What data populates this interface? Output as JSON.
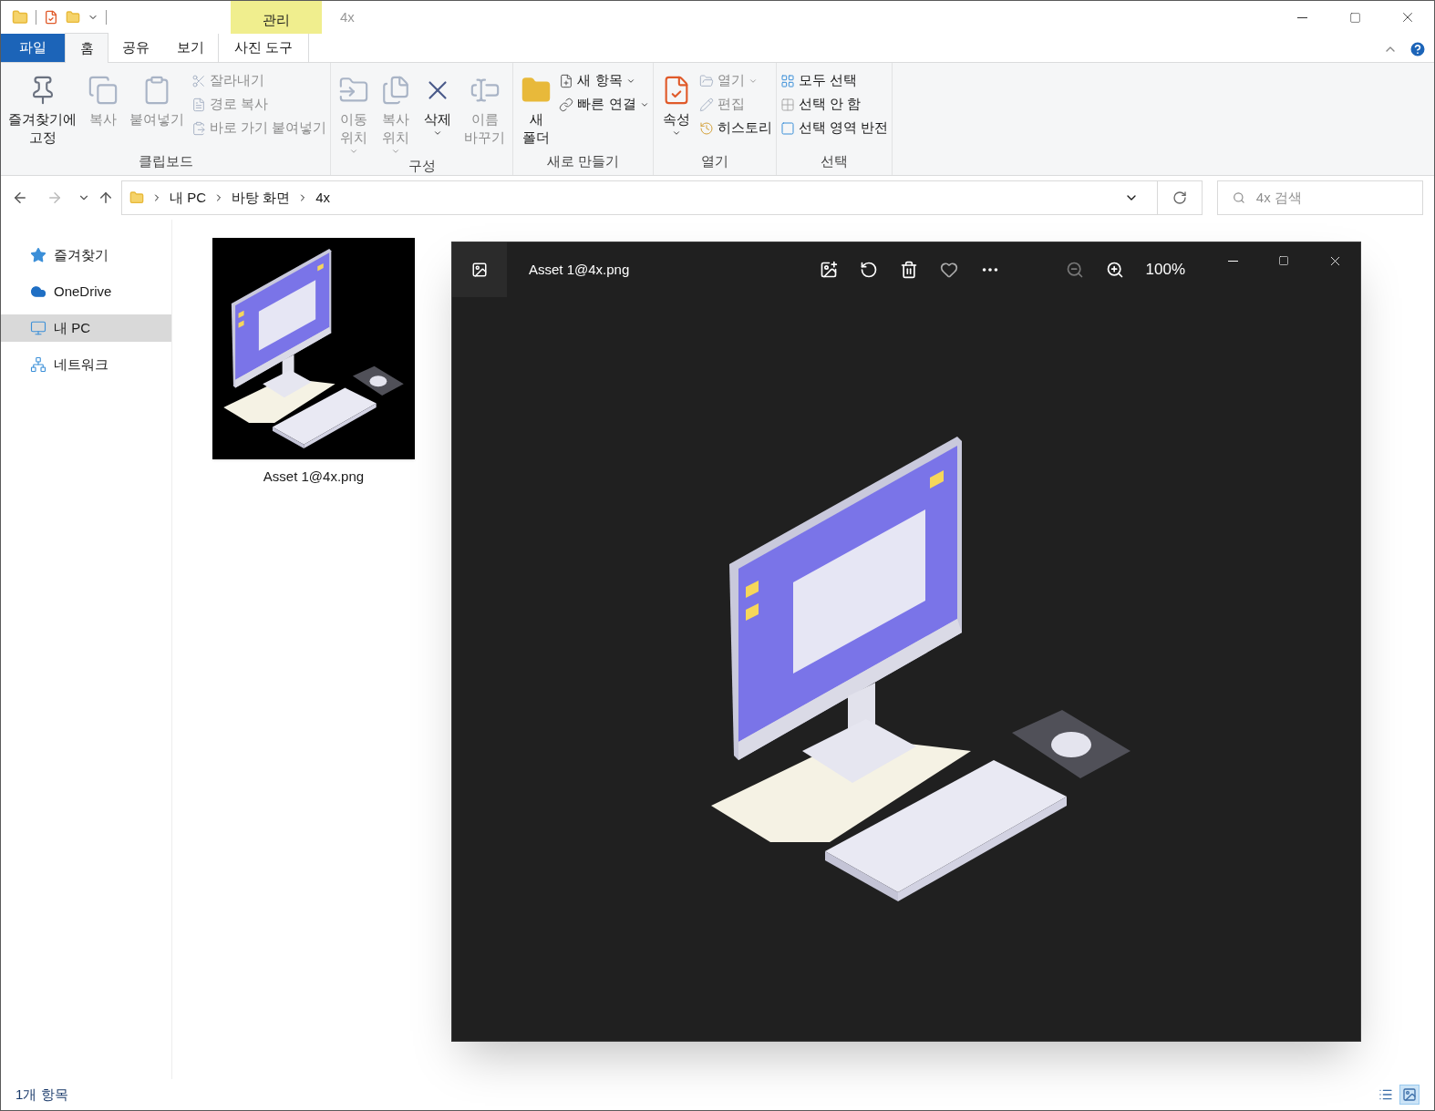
{
  "title_bar": {
    "contextual_tab": "관리",
    "title": "4x"
  },
  "ribbon_tabs": [
    {
      "label": "파일",
      "kind": "file",
      "selected": false
    },
    {
      "label": "홈",
      "kind": "normal",
      "selected": true
    },
    {
      "label": "공유",
      "kind": "normal",
      "selected": false
    },
    {
      "label": "보기",
      "kind": "normal",
      "selected": false
    },
    {
      "label": "사진 도구",
      "kind": "contextual",
      "selected": false
    }
  ],
  "ribbon_groups": [
    {
      "label": "클립보드",
      "items": [
        {
          "kind": "large",
          "lines": [
            "즐겨찾기에",
            "고정"
          ],
          "disabled": false,
          "dropdown": false
        },
        {
          "kind": "large",
          "lines": [
            "복사"
          ],
          "disabled": true,
          "dropdown": false
        },
        {
          "kind": "large",
          "lines": [
            "붙여넣기"
          ],
          "disabled": true,
          "dropdown": false
        },
        {
          "kind": "stack",
          "entries": [
            {
              "label": "잘라내기",
              "disabled": true,
              "dropdown": false
            },
            {
              "label": "경로 복사",
              "disabled": true,
              "dropdown": false
            },
            {
              "label": "바로 가기 붙여넣기",
              "disabled": true,
              "dropdown": false
            }
          ]
        }
      ]
    },
    {
      "label": "구성",
      "items": [
        {
          "kind": "large",
          "lines": [
            "이동",
            "위치"
          ],
          "disabled": true,
          "dropdown": true
        },
        {
          "kind": "large",
          "lines": [
            "복사",
            "위치"
          ],
          "disabled": true,
          "dropdown": true
        },
        {
          "kind": "large",
          "lines": [
            "삭제"
          ],
          "disabled": false,
          "dropdown": true
        },
        {
          "kind": "large",
          "lines": [
            "이름",
            "바꾸기"
          ],
          "disabled": true,
          "dropdown": false
        }
      ]
    },
    {
      "label": "새로 만들기",
      "items": [
        {
          "kind": "large",
          "lines": [
            "새",
            "폴더"
          ],
          "disabled": false,
          "dropdown": false
        },
        {
          "kind": "stack",
          "entries": [
            {
              "label": "새 항목",
              "disabled": false,
              "dropdown": true
            },
            {
              "label": "빠른 연결",
              "disabled": false,
              "dropdown": true
            }
          ]
        }
      ]
    },
    {
      "label": "열기",
      "items": [
        {
          "kind": "large",
          "lines": [
            "속성"
          ],
          "disabled": false,
          "dropdown": true
        },
        {
          "kind": "stack",
          "entries": [
            {
              "label": "열기",
              "disabled": true,
              "dropdown": true
            },
            {
              "label": "편집",
              "disabled": true,
              "dropdown": false
            },
            {
              "label": "히스토리",
              "disabled": false,
              "dropdown": false
            }
          ]
        }
      ]
    },
    {
      "label": "선택",
      "items": [
        {
          "kind": "stack",
          "entries": [
            {
              "label": "모두 선택",
              "disabled": false,
              "dropdown": false
            },
            {
              "label": "선택 안 함",
              "disabled": false,
              "dropdown": false
            },
            {
              "label": "선택 영역 반전",
              "disabled": false,
              "dropdown": false
            }
          ]
        }
      ]
    }
  ],
  "address": {
    "crumbs": [
      "내 PC",
      "바탕 화면",
      "4x"
    ],
    "search_placeholder": "4x 검색"
  },
  "sidebar": [
    {
      "label": "즐겨찾기",
      "selected": false
    },
    {
      "label": "OneDrive",
      "selected": false
    },
    {
      "label": "내 PC",
      "selected": true
    },
    {
      "label": "네트워크",
      "selected": false
    }
  ],
  "files": [
    {
      "name": "Asset 1@4x.png"
    }
  ],
  "viewer": {
    "title": "Asset 1@4x.png",
    "zoom": "100%",
    "zoom_out_disabled": true
  },
  "status_bar": {
    "count": "1개 항목"
  },
  "view_modes": [
    {
      "kind": "details",
      "selected": false
    },
    {
      "kind": "large_icons",
      "selected": true
    }
  ]
}
